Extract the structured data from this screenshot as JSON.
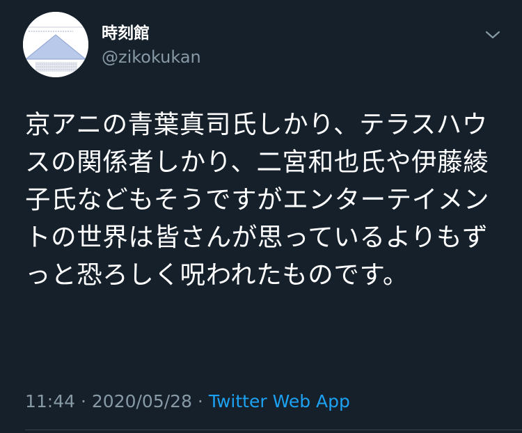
{
  "author": {
    "display_name": "時刻館",
    "handle": "@zikokukan",
    "avatar_icon": "pyramid-diagram-avatar"
  },
  "menu": {
    "icon": "chevron-down-icon"
  },
  "tweet": {
    "text": "京アニの青葉真司氏しかり、テラスハウスの関係者しかり、二宮和也氏や伊藤綾子氏などもそうですがエンターテイメントの世界は皆さんが思っているよりもずっと恐ろしく呪われたものです。",
    "time": "11:44",
    "separator1": " · ",
    "date": "2020/05/28",
    "separator2": " · ",
    "source": "Twitter Web App"
  },
  "colors": {
    "background": "#15202b",
    "text": "#ffffff",
    "secondary": "#8899a6",
    "link": "#1da1f2",
    "divider": "#38444d"
  }
}
